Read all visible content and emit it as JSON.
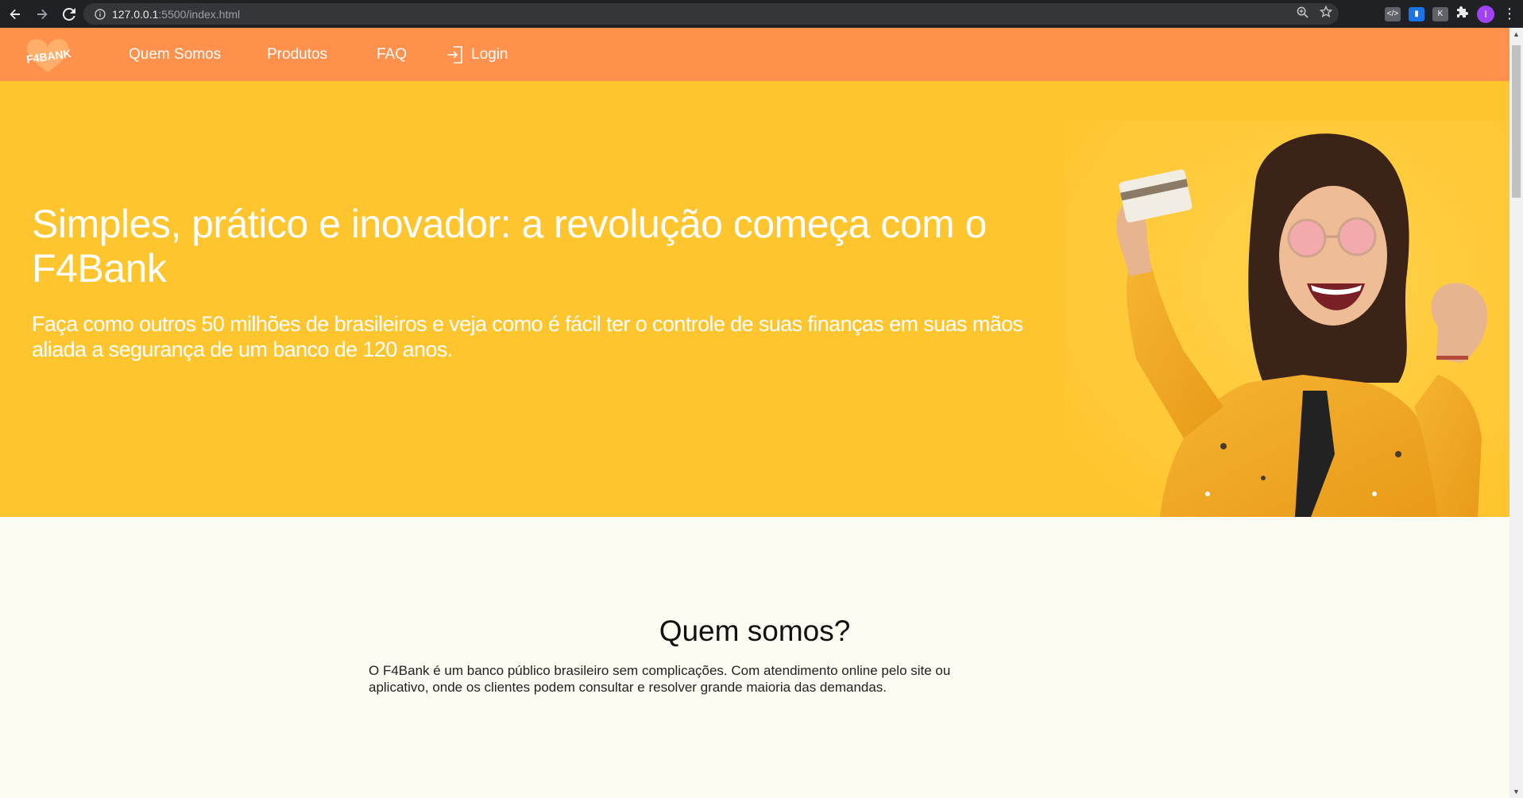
{
  "browser": {
    "url_host": "127.0.0.1",
    "url_path": ":5500/index.html",
    "avatar_letter": "I"
  },
  "site": {
    "logo_text": "F4BANK",
    "nav": {
      "about": "Quem Somos",
      "products": "Produtos",
      "faq": "FAQ",
      "login": "Login"
    }
  },
  "hero": {
    "title": "Simples, prático e inovador: a revolução começa com o F4Bank",
    "subtitle": "Faça como outros 50 milhões de brasileiros e veja como é fácil ter o controle de suas finanças em suas mãos aliada a segurança de um banco de 120 anos."
  },
  "about": {
    "heading": "Quem somos?",
    "text": "O F4Bank é um banco público brasileiro sem complicações. Com atendimento online pelo site ou aplicativo, onde os clientes podem consultar e resolver grande maioria das demandas."
  },
  "colors": {
    "header": "#ff914d",
    "hero": "#ffc52f",
    "page": "#fefbf2"
  }
}
